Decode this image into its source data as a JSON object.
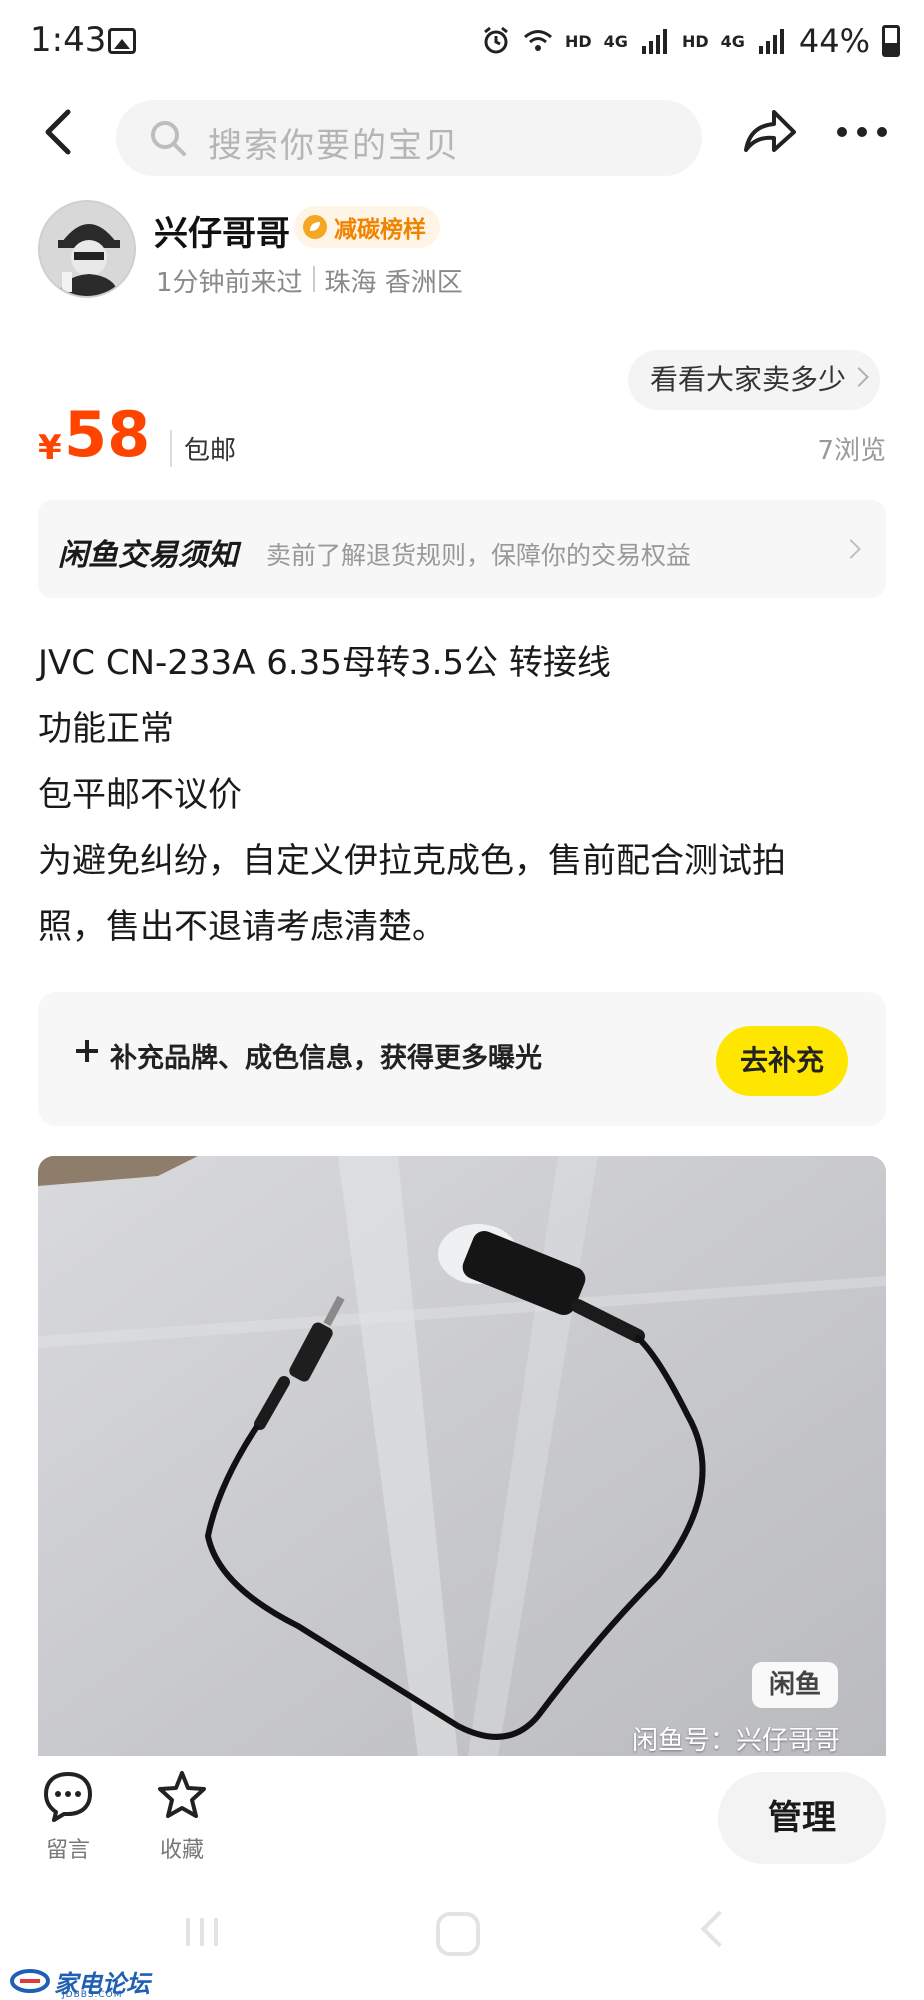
{
  "status_bar": {
    "time": "1:43",
    "hd1": "HD",
    "net1": "4G",
    "hd2": "HD",
    "net2": "4G",
    "battery": "44%"
  },
  "top_nav": {
    "search_placeholder": "搜索你要的宝贝"
  },
  "seller": {
    "name": "兴仔哥哥",
    "badge": "减碳榜样",
    "last_seen": "1分钟前来过",
    "location": "珠海 香洲区"
  },
  "price": {
    "currency": "¥",
    "value": "58",
    "shipping": "包邮",
    "check_prices": "看看大家卖多少",
    "views": "7浏览"
  },
  "notice": {
    "title": "闲鱼交易须知",
    "description": "卖前了解退货规则，保障你的交易权益"
  },
  "description": {
    "lines": [
      "JVC CN-233A 6.35母转3.5公 转接线",
      "功能正常",
      "包平邮不议价",
      "为避免纠纷，自定义伊拉克成色，售前配合测试拍",
      "照，售出不退请考虑清楚。"
    ]
  },
  "supplement": {
    "text": "补充品牌、成色信息，获得更多曝光",
    "button": "去补充"
  },
  "photo": {
    "watermark_logo": "闲鱼",
    "watermark_text": "闲鱼号：兴仔哥哥"
  },
  "bottom_bar": {
    "comment": "留言",
    "favorite": "收藏",
    "manage": "管理"
  },
  "footer": {
    "forum_name": "家电论坛",
    "forum_domain": "JDBBS.COM"
  },
  "colors": {
    "price": "#ff4400",
    "accent_yellow": "#ffe600",
    "badge_orange": "#f08300"
  }
}
